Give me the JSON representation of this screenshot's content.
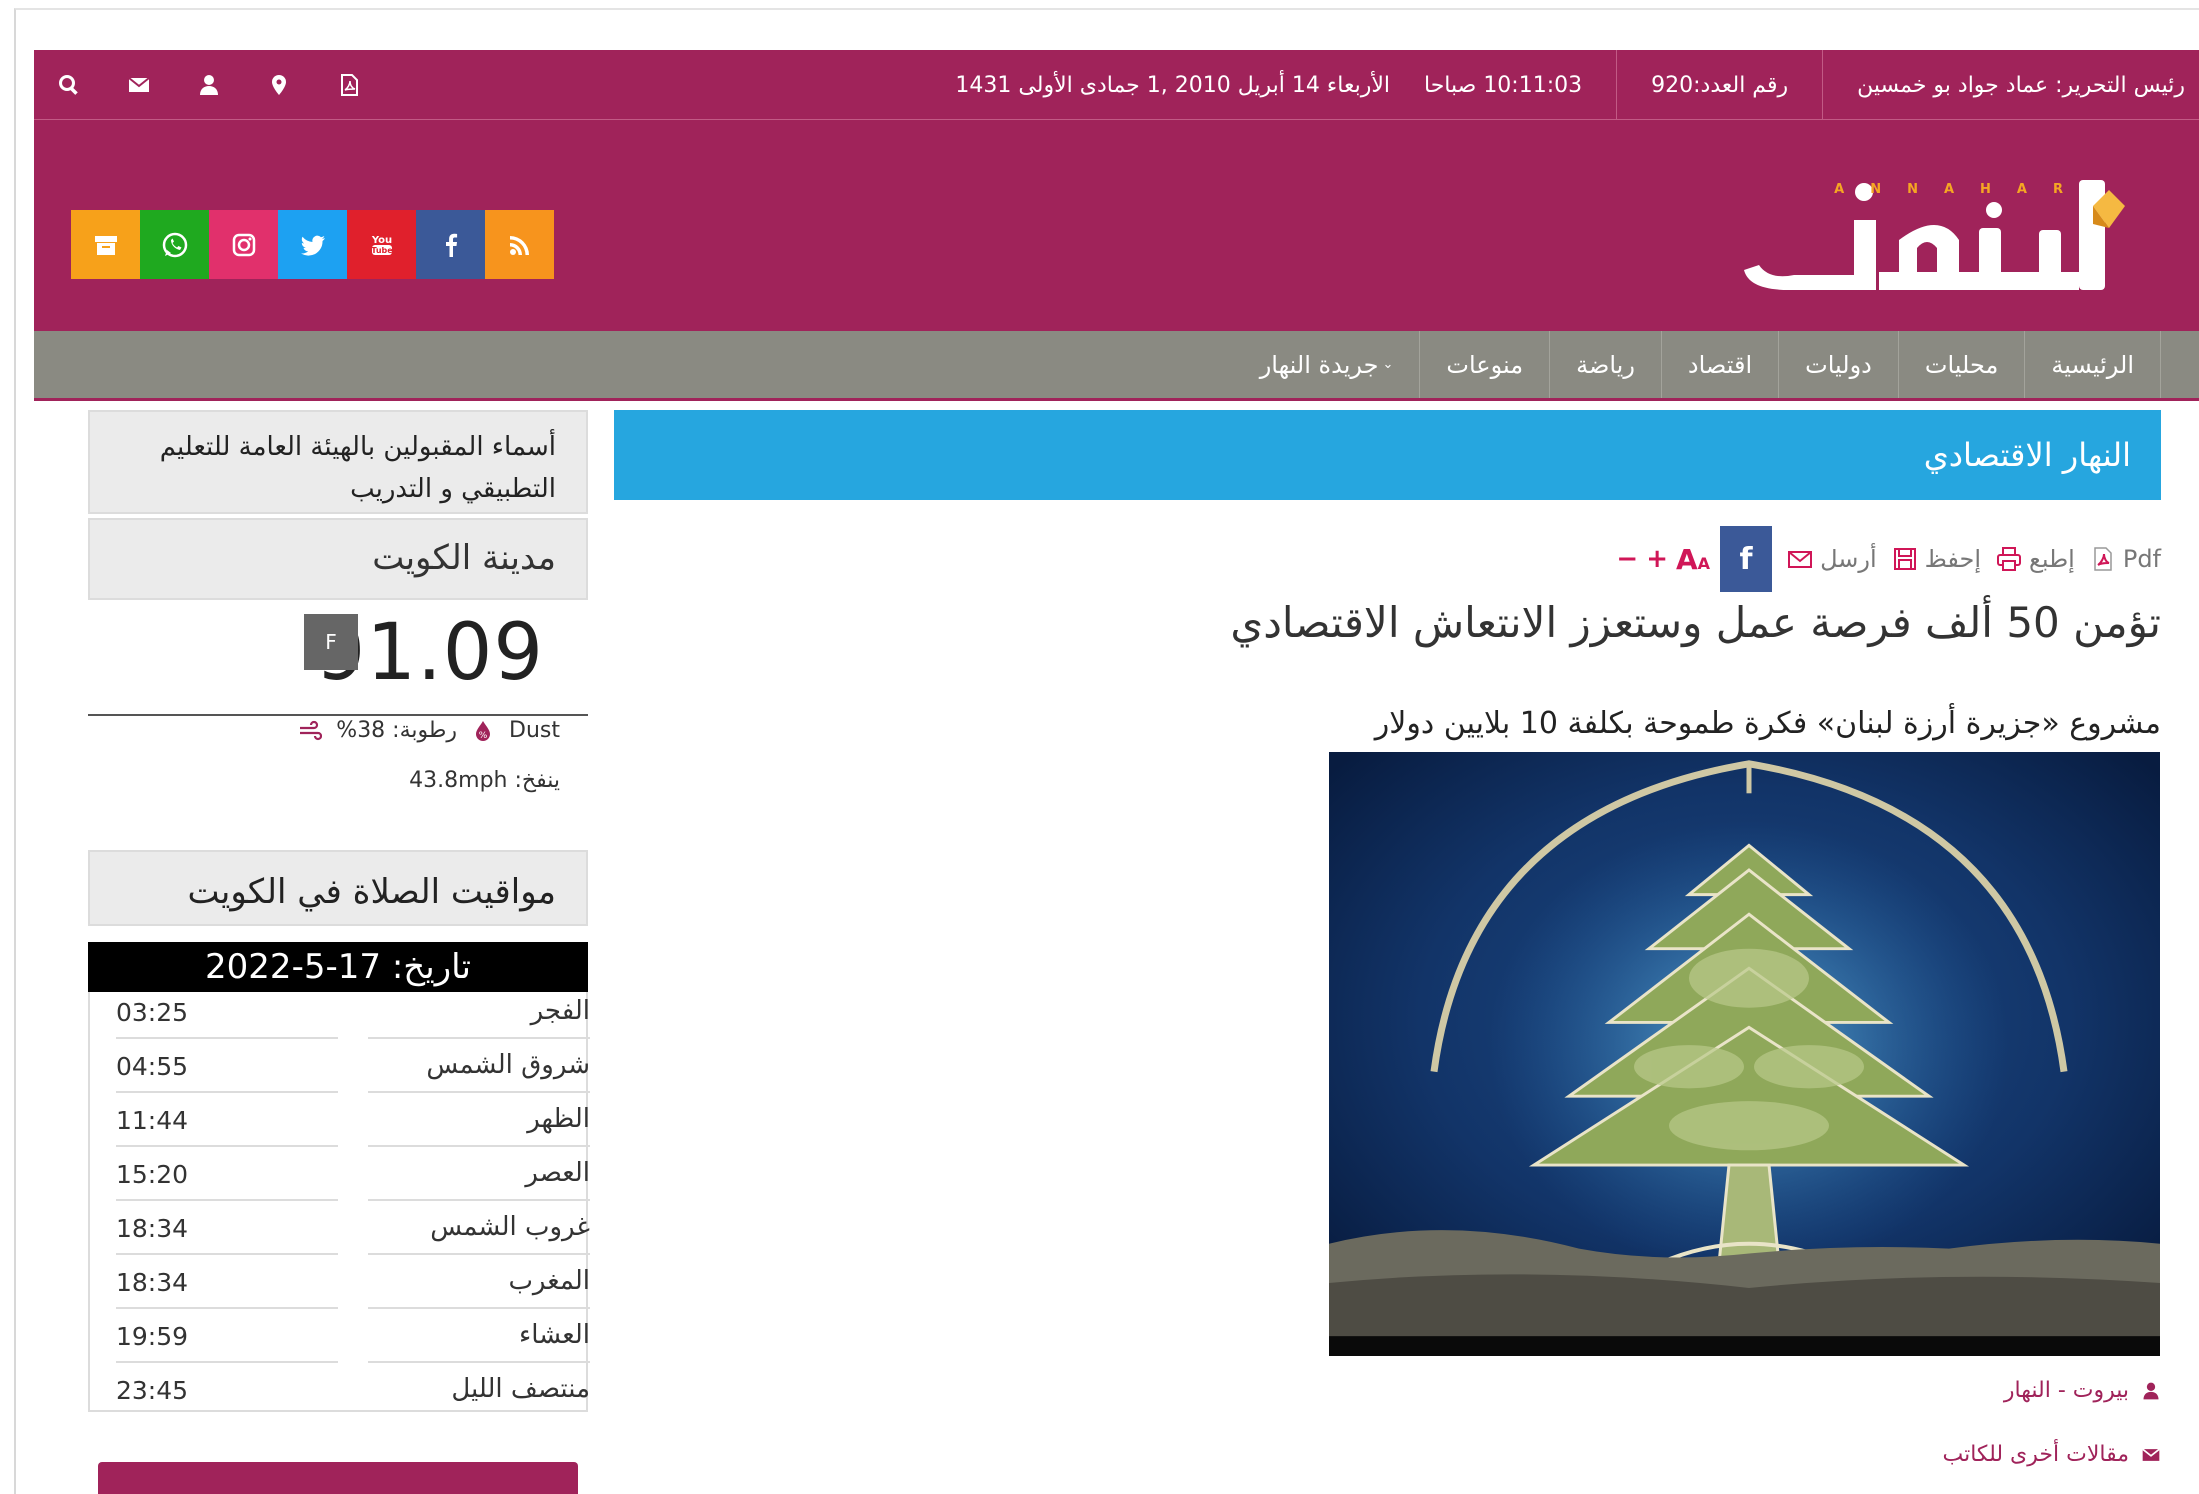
{
  "topbar": {
    "date": "الأربعاء 14 أبريل 2010 ,1 جمادى الأولى 1431",
    "time": "10:11:03 صباحا",
    "issue": "رقم العدد:920",
    "editor": "رئيس التحرير: عماد جواد بو خمسين",
    "icons": [
      "pdf-icon",
      "location-icon",
      "user-icon",
      "mail-icon",
      "search-icon"
    ]
  },
  "header": {
    "logo_text": "النهار",
    "logo_latin": "ANNAHAR",
    "social": [
      {
        "name": "rss-icon",
        "color": "#f7941d"
      },
      {
        "name": "facebook-icon",
        "color": "#3b5998"
      },
      {
        "name": "youtube-icon",
        "color": "#e0202c"
      },
      {
        "name": "twitter-icon",
        "color": "#1da1f2"
      },
      {
        "name": "instagram-icon",
        "color": "#e1306c"
      },
      {
        "name": "whatsapp-icon",
        "color": "#1fa91f"
      },
      {
        "name": "archive-icon",
        "color": "#f7a11a"
      }
    ]
  },
  "nav": {
    "items": [
      "الرئيسية",
      "محليات",
      "دوليات",
      "اقتصاد",
      "رياضة",
      "منوعات",
      "جريدة النهار"
    ]
  },
  "section": {
    "title": "النهار الاقتصادي"
  },
  "article": {
    "toolbar": {
      "font_minus": "−",
      "font_plus": "+",
      "facebook": "f",
      "send": "أرسل",
      "save": "إحفظ",
      "print": "إطبع",
      "pdf": "Pdf"
    },
    "headline": "تؤمن 50 ألف فرصة عمل وستعزز الانتعاش الاقتصادي",
    "subhead": "مشروع «جزيرة أرزة لبنان» فكرة طموحة بكلفة 10 بلايين دولار",
    "author": "بيروت - النهار",
    "more_articles": "مقالات أخرى للكاتب"
  },
  "sidebar": {
    "notice": "أسماء المقبولين بالهيئة العامة للتعليم التطبيقي و التدريب",
    "weather": {
      "city": "مدينة الكويت",
      "temperature": "91.09",
      "unit": "F",
      "condition": "Dust",
      "humidity": "رطوبة: 38%",
      "wind": "ينفخ: 43.8mph"
    },
    "prayer": {
      "title": "مواقيت الصلاة في الكويت",
      "date": "تاريخ: 17-5-2022",
      "times": [
        {
          "name": "الفجر",
          "time": "03:25"
        },
        {
          "name": "شروق الشمس",
          "time": "04:55"
        },
        {
          "name": "الظهر",
          "time": "11:44"
        },
        {
          "name": "العصر",
          "time": "15:20"
        },
        {
          "name": "غروب الشمس",
          "time": "18:34"
        },
        {
          "name": "المغرب",
          "time": "18:34"
        },
        {
          "name": "العشاء",
          "time": "19:59"
        },
        {
          "name": "منتصف الليل",
          "time": "23:45"
        }
      ]
    }
  },
  "colors": {
    "brand": "#a0235a",
    "nav": "#8a8a82",
    "section": "#26a6df",
    "logo_accent": "#f5a623"
  }
}
